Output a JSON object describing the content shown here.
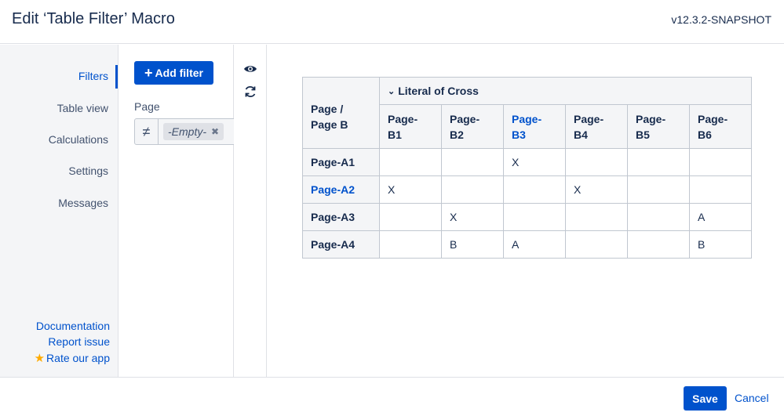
{
  "header": {
    "title": "Edit ‘Table Filter’ Macro",
    "version": "v12.3.2-SNAPSHOT"
  },
  "sidebar": {
    "items": [
      {
        "label": "Filters",
        "active": true
      },
      {
        "label": "Table view",
        "active": false
      },
      {
        "label": "Calculations",
        "active": false
      },
      {
        "label": "Settings",
        "active": false
      },
      {
        "label": "Messages",
        "active": false
      }
    ],
    "links": {
      "documentation": "Documentation",
      "report": "Report issue",
      "rate": "Rate our app"
    }
  },
  "filters": {
    "add_label": "Add filter",
    "field_label": "Page",
    "operator_symbol": "≠",
    "chip_value": "-Empty-",
    "chip_remove": "✖"
  },
  "tools": {
    "icons": [
      "eye-icon",
      "refresh-icon"
    ]
  },
  "table": {
    "corner_line1": "Page /",
    "corner_line2": "Page B",
    "group_label": "Literal of Cross",
    "columns": [
      {
        "line1": "Page-",
        "line2": "B1"
      },
      {
        "line1": "Page-",
        "line2": "B2"
      },
      {
        "line1": "Page-",
        "line2": "B3"
      },
      {
        "line1": "Page-",
        "line2": "B4"
      },
      {
        "line1": "Page-",
        "line2": "B5"
      },
      {
        "line1": "Page-",
        "line2": "B6"
      }
    ],
    "rows": [
      {
        "label": "Page-A1",
        "cells": [
          "",
          "",
          "X",
          "",
          "",
          ""
        ]
      },
      {
        "label": "Page-A2",
        "cells": [
          "X",
          "",
          "",
          "X",
          "",
          ""
        ]
      },
      {
        "label": "Page-A3",
        "cells": [
          "",
          "X",
          "",
          "",
          "",
          "A"
        ]
      },
      {
        "label": "Page-A4",
        "cells": [
          "",
          "B",
          "A",
          "",
          "",
          "B"
        ]
      }
    ]
  },
  "footer": {
    "save_label": "Save",
    "cancel_label": "Cancel"
  },
  "colors": {
    "accent": "#0052cc",
    "sidebar_bg": "#f4f5f7",
    "star": "#ffab00"
  }
}
